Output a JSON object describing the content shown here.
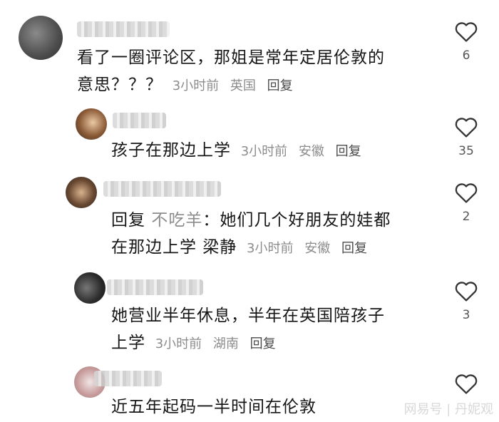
{
  "comments": [
    {
      "text_lines": [
        "看了一圈评论区，那姐是常年定居伦敦的",
        "意思？？？"
      ],
      "time": "3小时前",
      "location": "英国",
      "reply_label": "回复",
      "likes": "6"
    },
    {
      "text_lines": [
        "孩子在那边上学"
      ],
      "time": "3小时前",
      "location": "安徽",
      "reply_label": "回复",
      "likes": "35"
    },
    {
      "reply_prefix": "回复",
      "reply_target": "不吃羊",
      "text_lines": [
        "：她们几个好朋友的娃都",
        "在那边上学 梁静"
      ],
      "time": "3小时前",
      "location": "安徽",
      "reply_label": "回复",
      "likes": "2"
    },
    {
      "text_lines": [
        "她营业半年休息，半年在英国陪孩子",
        "上学"
      ],
      "time": "3小时前",
      "location": "湖南",
      "reply_label": "回复",
      "likes": "3"
    },
    {
      "text_lines": [
        "近五年起码一半时间在伦敦"
      ],
      "likes": ""
    }
  ],
  "watermark": "网易号 | 丹妮观",
  "icons": {
    "like": "heart-outline-icon"
  }
}
